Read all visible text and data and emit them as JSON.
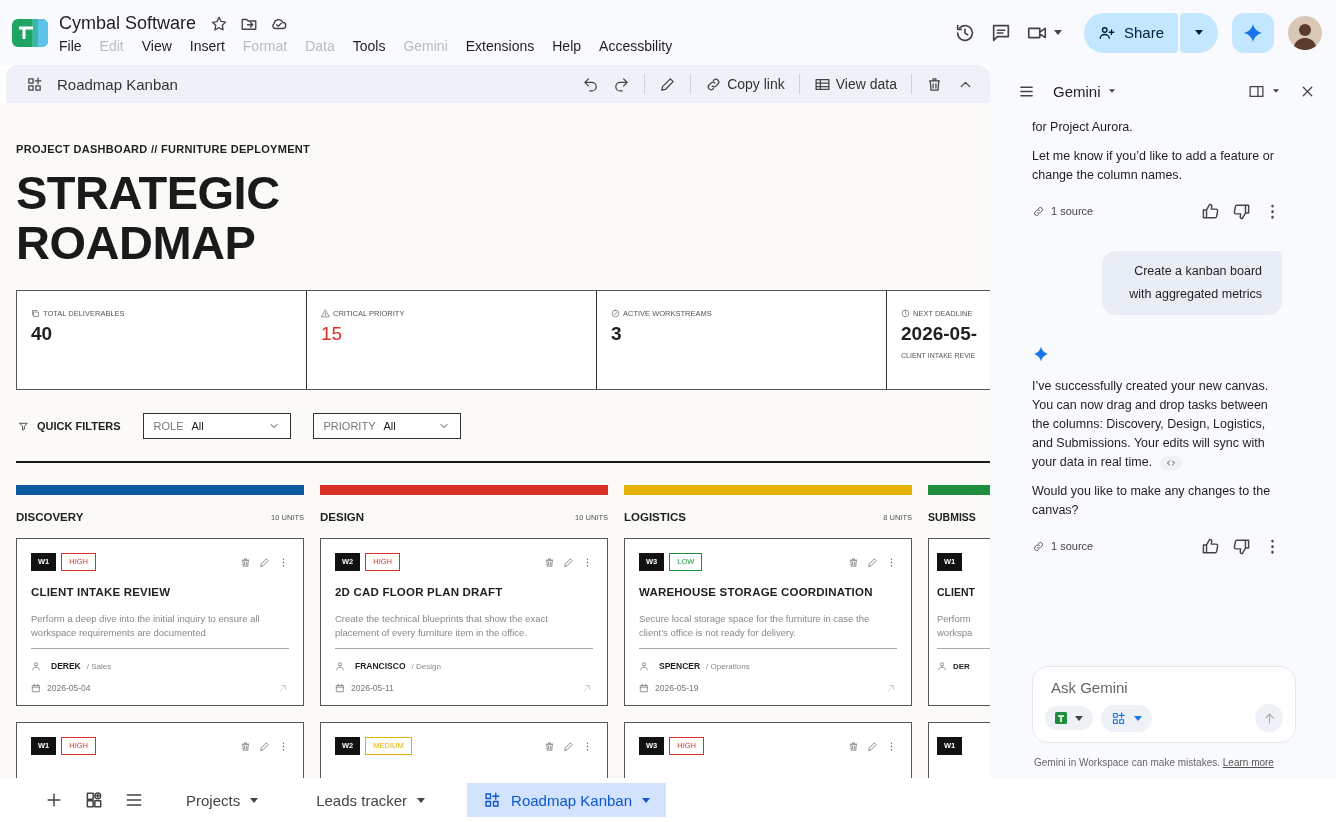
{
  "app": {
    "title": "Cymbal Software",
    "menu": [
      {
        "label": "File",
        "disabled": false
      },
      {
        "label": "Edit",
        "disabled": true
      },
      {
        "label": "View",
        "disabled": false
      },
      {
        "label": "Insert",
        "disabled": false
      },
      {
        "label": "Format",
        "disabled": true
      },
      {
        "label": "Data",
        "disabled": true
      },
      {
        "label": "Tools",
        "disabled": false
      },
      {
        "label": "Gemini",
        "disabled": true
      },
      {
        "label": "Extensions",
        "disabled": false
      },
      {
        "label": "Help",
        "disabled": false
      },
      {
        "label": "Accessbility",
        "disabled": false
      }
    ],
    "share": "Share"
  },
  "toolbar": {
    "title": "Roadmap Kanban",
    "copy_link": "Copy link",
    "view_data": "View data"
  },
  "dashboard": {
    "eyebrow": "PROJECT DASHBOARD // FURNITURE DEPLOYMENT",
    "title": "STRATEGIC ROADMAP",
    "stats": [
      {
        "kind": "total",
        "label": "TOTAL DELIVERABLES",
        "value": "40"
      },
      {
        "kind": "critical",
        "label": "CRITICAL PRIORITY",
        "value": "15"
      },
      {
        "kind": "workstreams",
        "label": "ACTIVE WORKSTREAMS",
        "value": "3"
      },
      {
        "kind": "deadline",
        "label": "NEXT DEADLINE",
        "value": "2026-05-",
        "note": "CLIENT INTAKE REVIE"
      }
    ],
    "filters": {
      "label": "QUICK FILTERS",
      "dropdowns": [
        {
          "label": "ROLE",
          "value": "All"
        },
        {
          "label": "PRIORITY",
          "value": "All"
        }
      ]
    },
    "columns": [
      {
        "title": "DISCOVERY",
        "count": "10 UNITS",
        "color": "#0b5aa0",
        "cards": [
          {
            "week": "W1",
            "priority": {
              "label": "HIGH",
              "color": "#d93025"
            },
            "title": "CLIENT INTAKE REVIEW",
            "description": "Perform a deep dive into the initial inquiry to ensure all workspace requirements are documented",
            "person": "DEREK",
            "role": "/ Sales",
            "date": "2026-05-04"
          },
          {
            "week": "W1",
            "priority": {
              "label": "HIGH",
              "color": "#d93025"
            }
          }
        ]
      },
      {
        "title": "DESIGN",
        "count": "10 UNITS",
        "color": "#d93025",
        "cards": [
          {
            "week": "W2",
            "priority": {
              "label": "HIGH",
              "color": "#d93025"
            },
            "title": "2D CAD FLOOR PLAN DRAFT",
            "description": "Create the technical blueprints that show the exact placement of every furniture item in the office.",
            "person": "FRANCISCO",
            "role": "/ Design",
            "date": "2026-05-11"
          },
          {
            "week": "W2",
            "priority": {
              "label": "MEDIUM",
              "color": "#e3b000"
            }
          }
        ]
      },
      {
        "title": "LOGISTICS",
        "count": "8 UNITS",
        "color": "#e8b000",
        "cards": [
          {
            "week": "W3",
            "priority": {
              "label": "LOW",
              "color": "#1e8e3e"
            },
            "title": "WAREHOUSE STORAGE COORDINATION",
            "description": "Secure local storage space for the furniture in case the client’s office is not ready for delivery.",
            "person": "SPENCER",
            "role": "/ Operations",
            "date": "2026-05-19"
          },
          {
            "week": "W3",
            "priority": {
              "label": "HIGH",
              "color": "#d93025"
            }
          }
        ]
      },
      {
        "title": "SUBMISS",
        "color": "#1e8e3e",
        "cards": [
          {
            "week": "W1",
            "title": "CLIENT",
            "description": "Perform\nworkspa",
            "person": "DER"
          },
          {
            "week": "W1"
          }
        ]
      }
    ]
  },
  "gemini": {
    "title": "Gemini",
    "messages": [
      {
        "kind": "model",
        "spark": false,
        "code_chip": false,
        "paragraphs": [
          "for Project Aurora.",
          "Let me know if you’d like to add a feature or change the column names."
        ],
        "sources": "1 source"
      },
      {
        "kind": "user",
        "text": "Create a kanban board with aggregated metrics"
      },
      {
        "kind": "model",
        "spark": true,
        "code_chip": true,
        "paragraphs": [
          "I’ve successfully created your new canvas. You can now drag and drop tasks between the columns: Discovery, Design, Logistics, and Submissions. Your edits will sync with your data in real time.",
          "Would you like to make any changes to the canvas?"
        ],
        "sources": "1 source"
      }
    ],
    "input": {
      "placeholder": "Ask Gemini"
    },
    "disclaimer": "Gemini in Workspace can make mistakes.",
    "link": "Learn more"
  },
  "sheet_tabs": [
    {
      "label": "Projects",
      "kind": "sheet",
      "selected": false
    },
    {
      "label": "Leads tracker",
      "kind": "sheet",
      "selected": false
    },
    {
      "label": "Roadmap Kanban",
      "kind": "canvas",
      "selected": true
    }
  ]
}
